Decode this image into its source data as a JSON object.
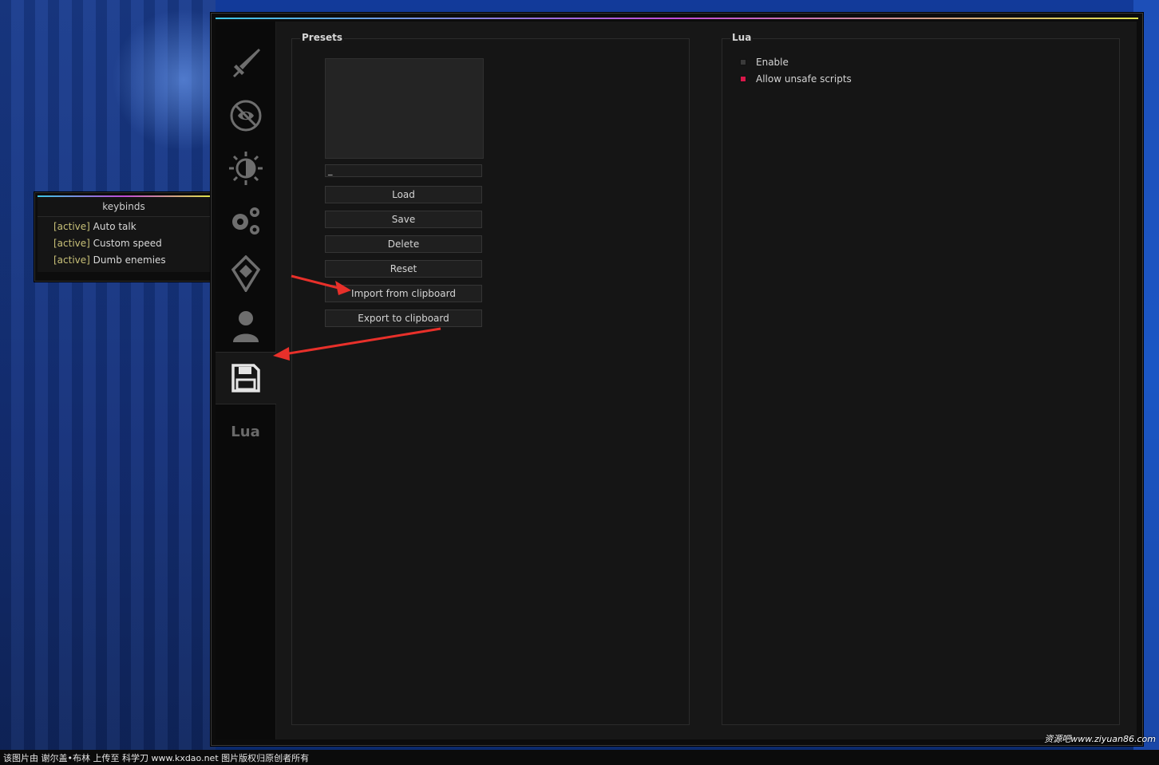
{
  "keybinds": {
    "title": "keybinds",
    "items": [
      {
        "state": "[active]",
        "name": "Auto talk"
      },
      {
        "state": "[active]",
        "name": "Custom speed"
      },
      {
        "state": "[active]",
        "name": "Dumb enemies"
      }
    ]
  },
  "sidebar": {
    "tabs": [
      {
        "icon": "sword-icon"
      },
      {
        "icon": "eye-crossed-icon"
      },
      {
        "icon": "brightness-icon"
      },
      {
        "icon": "gears-icon"
      },
      {
        "icon": "map-marker-icon"
      },
      {
        "icon": "user-icon"
      },
      {
        "icon": "floppy-disk-icon",
        "active": true
      },
      {
        "label": "Lua"
      }
    ]
  },
  "presets": {
    "title": "Presets",
    "name_value": "_",
    "buttons": {
      "load": "Load",
      "save": "Save",
      "delete": "Delete",
      "reset": "Reset",
      "import": "Import from clipboard",
      "export": "Export to clipboard"
    }
  },
  "lua": {
    "title": "Lua",
    "options": [
      {
        "label": "Enable",
        "checked": false
      },
      {
        "label": "Allow unsafe scripts",
        "checked": true
      }
    ]
  },
  "footer": {
    "caption": "该图片由 谢尔盖•布林 上传至 科学刀 www.kxdao.net 图片版权归原创者所有",
    "watermark": "资源吧www.ziyuan86.com"
  },
  "colors": {
    "accent_check": "#d8184a",
    "active_state": "#c8c078",
    "annotation_arrow": "#e8302a"
  }
}
